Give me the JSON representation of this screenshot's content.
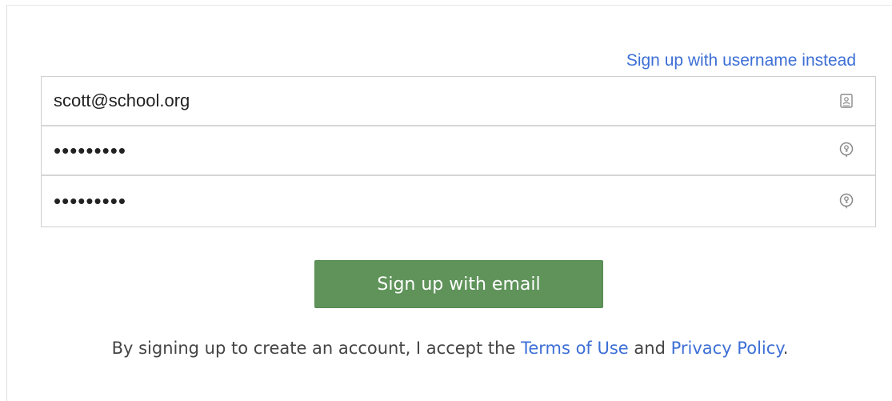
{
  "signup": {
    "alt_link": "Sign up with username instead",
    "email_value": "scott@school.org",
    "password_value": "•••••••••",
    "confirm_value": "•••••••••",
    "submit_label": "Sign up with email"
  },
  "terms": {
    "prefix": "By signing up to create an account, I accept the ",
    "terms_link": "Terms of Use",
    "and": " and ",
    "privacy_link": "Privacy Policy",
    "suffix": "."
  },
  "icons": {
    "email": "contact-card-icon",
    "password": "key-icon",
    "confirm": "key-icon"
  },
  "colors": {
    "link": "#3d6fd6",
    "button": "#5f935a",
    "border": "#cfcfcf"
  }
}
